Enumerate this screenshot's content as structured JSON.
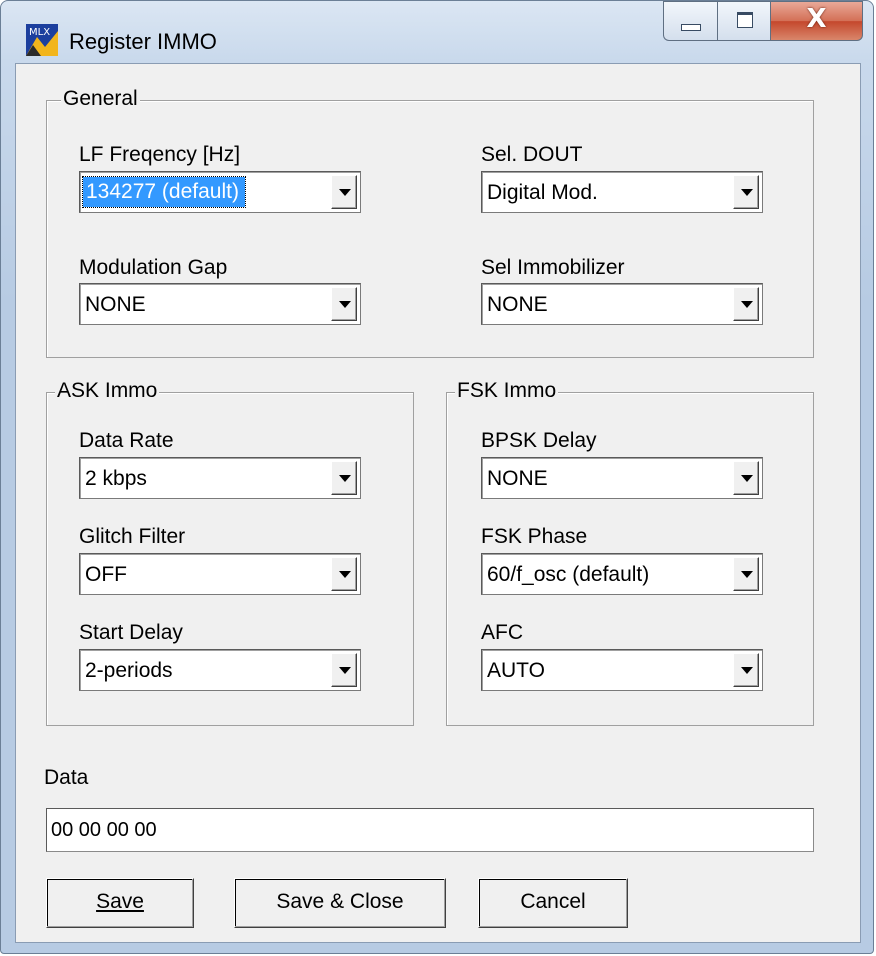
{
  "window": {
    "title": "Register IMMO",
    "close_glyph": "X"
  },
  "general": {
    "title": "General",
    "lf_frequency": {
      "label": "LF Freqency [Hz]",
      "value": "134277 (default)"
    },
    "sel_dout": {
      "label": "Sel. DOUT",
      "value": "Digital Mod."
    },
    "modulation_gap": {
      "label": "Modulation Gap",
      "value": "NONE"
    },
    "sel_immobilizer": {
      "label": "Sel Immobilizer",
      "value": "NONE"
    }
  },
  "ask": {
    "title": "ASK Immo",
    "data_rate": {
      "label": "Data Rate",
      "value": "2 kbps"
    },
    "glitch_filter": {
      "label": "Glitch Filter",
      "value": "OFF"
    },
    "start_delay": {
      "label": "Start Delay",
      "value": "2-periods"
    }
  },
  "fsk": {
    "title": "FSK Immo",
    "bpsk_delay": {
      "label": "BPSK Delay",
      "value": "NONE"
    },
    "fsk_phase": {
      "label": "FSK Phase",
      "value": "60/f_osc (default)"
    },
    "afc": {
      "label": "AFC",
      "value": "AUTO"
    }
  },
  "data": {
    "label": "Data",
    "value": "00 00 00 00"
  },
  "buttons": {
    "save": "Save",
    "save_close": "Save & Close",
    "cancel": "Cancel"
  },
  "icons": {
    "app": "mlx-app-icon",
    "minimize": "minimize-icon",
    "maximize": "maximize-icon",
    "close": "close-icon",
    "dropdown": "chevron-down-icon"
  },
  "colors": {
    "selection": "#3399ff",
    "dialog_bg": "#f0f0f0",
    "close_button": "#c4472c"
  }
}
